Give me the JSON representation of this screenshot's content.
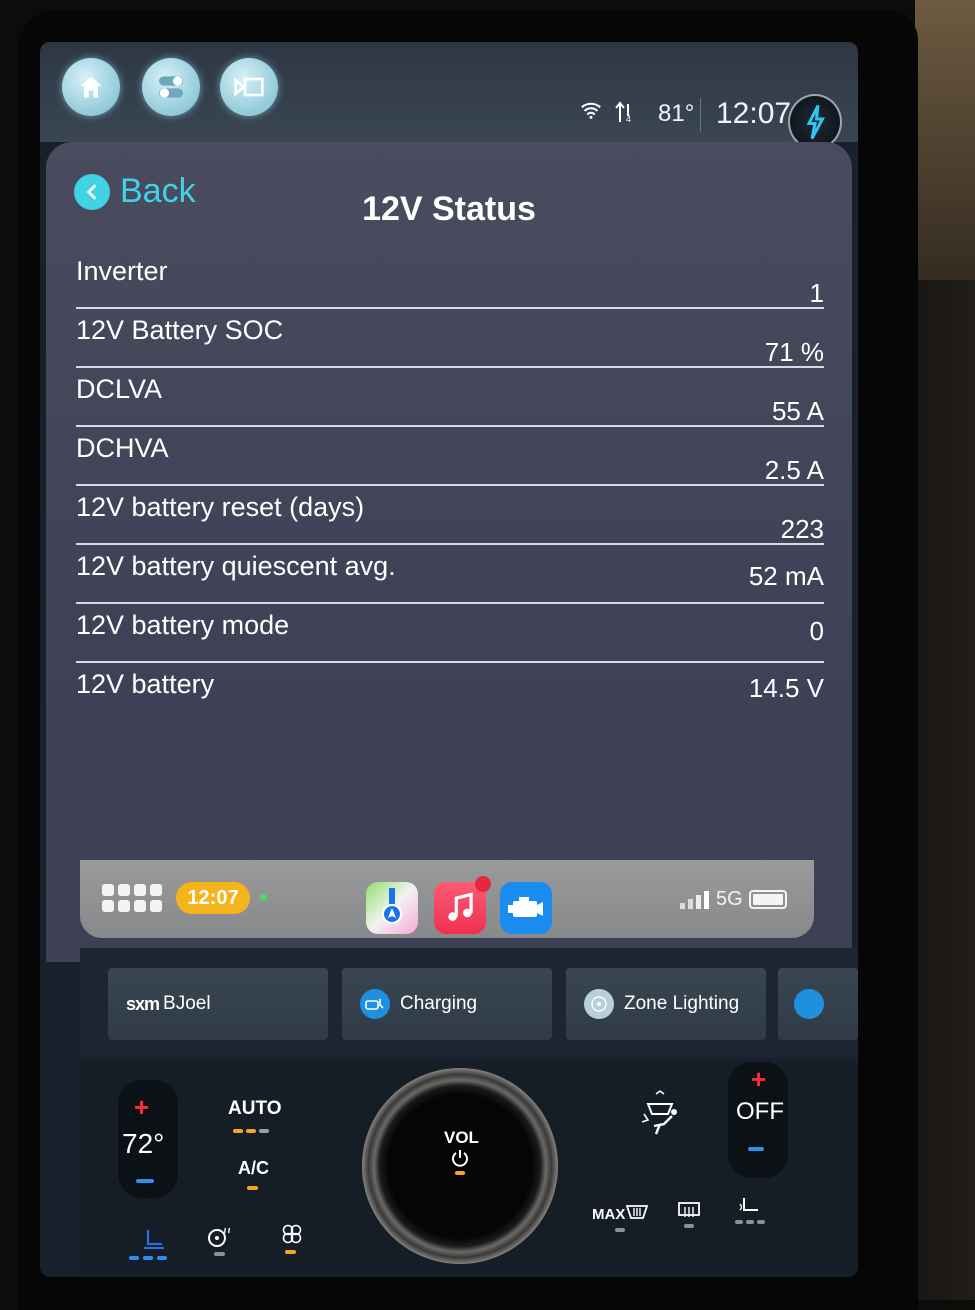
{
  "topbar": {
    "buttons": [
      {
        "name": "home",
        "icon": "home-icon"
      },
      {
        "name": "controls",
        "icon": "toggles-icon"
      },
      {
        "name": "camera",
        "icon": "camera-icon"
      }
    ],
    "temperature": "81°",
    "time": "12:07",
    "wifi_icon": "wifi-icon",
    "data_icon": "data-transfer-icon",
    "profile_icon": "lightning-icon"
  },
  "page": {
    "back_label": "Back",
    "title": "12V Status",
    "rows": [
      {
        "label": "Inverter",
        "value": "1"
      },
      {
        "label": "12V Battery SOC",
        "value": "71 %"
      },
      {
        "label": "DCLVA",
        "value": "55 A"
      },
      {
        "label": "DCHVA",
        "value": "2.5 A"
      },
      {
        "label": "12V battery reset (days)",
        "value": "223"
      },
      {
        "label": "12V battery quiescent avg.",
        "value": "52 mA"
      },
      {
        "label": "12V battery mode",
        "value": "0"
      },
      {
        "label": "12V battery",
        "value": "14.5 V"
      }
    ]
  },
  "dock": {
    "time": "12:07",
    "apps": [
      {
        "name": "Maps",
        "color": "#34c759"
      },
      {
        "name": "Music",
        "color": "#f0304f",
        "badge": true
      },
      {
        "name": "Engine",
        "color": "#1a8cf0"
      }
    ],
    "network": "5G"
  },
  "widgets": [
    {
      "label": "BJoel",
      "brand": "sxm"
    },
    {
      "label": "Charging"
    },
    {
      "label": "Zone Lighting"
    }
  ],
  "climate": {
    "driver_temp": "72°",
    "auto_label": "AUTO",
    "ac_label": "A/C",
    "vol_label": "VOL",
    "passenger_temp": "OFF",
    "max_label": "MAX",
    "plus": "+",
    "minus": "−"
  }
}
